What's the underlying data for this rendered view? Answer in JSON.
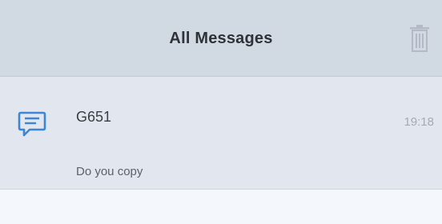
{
  "header": {
    "title": "All Messages",
    "action_icon": "trash-icon"
  },
  "messages": [
    {
      "icon": "message-icon",
      "sender": "G651",
      "time": "19:18",
      "preview": "Do you copy"
    }
  ],
  "colors": {
    "header_bg": "#d1d9e3",
    "row_bg": "#e2e6ee",
    "page_bg": "#f4f7fc",
    "accent": "#3b86d6",
    "trash_icon": "#b3bac5"
  }
}
